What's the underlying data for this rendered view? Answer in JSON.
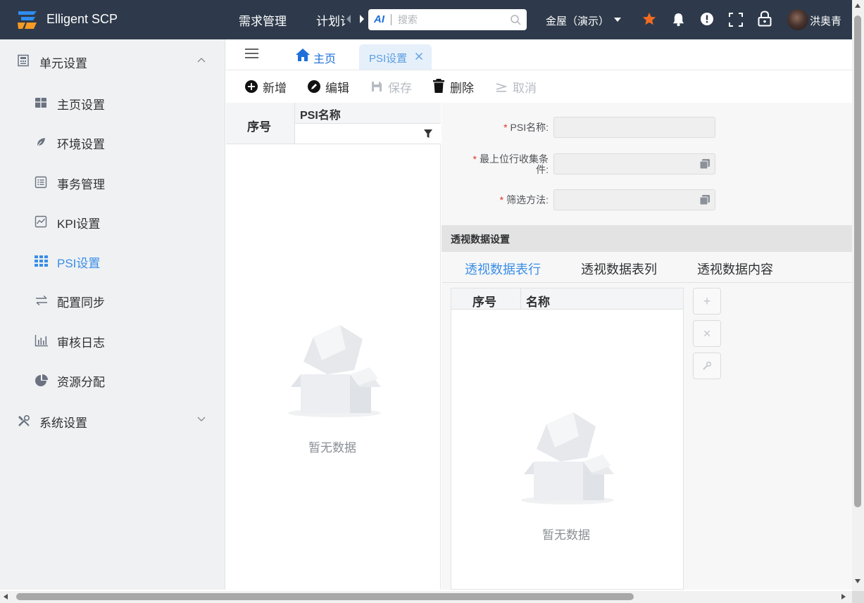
{
  "header": {
    "brand": "Elligent SCP",
    "nav": [
      "需求管理",
      "计划计"
    ],
    "search": {
      "ai_label": "AI",
      "placeholder": "搜索"
    },
    "tenant": "金屋（演示）",
    "user": "洪奥青",
    "icons": [
      "star-icon",
      "bell-icon",
      "alert-icon",
      "fullscreen-icon",
      "lock-icon"
    ],
    "colors": {
      "bar": "#2e3a4b",
      "star": "#f26b21"
    }
  },
  "sidebar": {
    "group1": "单元设置",
    "items": [
      {
        "label": "主页设置",
        "icon": "home-grid-icon"
      },
      {
        "label": "环境设置",
        "icon": "leaf-icon"
      },
      {
        "label": "事务管理",
        "icon": "list-icon"
      },
      {
        "label": "KPI设置",
        "icon": "line-chart-icon"
      },
      {
        "label": "PSI设置",
        "icon": "grid-icon",
        "active": true
      },
      {
        "label": "配置同步",
        "icon": "sync-arrows-icon"
      },
      {
        "label": "审核日志",
        "icon": "bar-chart-icon"
      },
      {
        "label": "资源分配",
        "icon": "pie-chart-icon"
      }
    ],
    "group2": "系统设置"
  },
  "tabs": {
    "home": "主页",
    "active": "PSI设置"
  },
  "toolbar": {
    "add": "新增",
    "edit": "编辑",
    "save": "保存",
    "delete": "删除",
    "cancel": "取消"
  },
  "left_grid": {
    "col_index": "序号",
    "col_name": "PSI名称",
    "empty": "暂无数据"
  },
  "form": {
    "psi_name_label": "PSI名称:",
    "condition_label_1": "最上位行收集条",
    "condition_label_2": "件:",
    "filter_label": "筛选方法:"
  },
  "pivot": {
    "section": "透视数据设置",
    "tabs": [
      "透视数据表行",
      "透视数据表列",
      "透视数据内容"
    ],
    "col_index": "序号",
    "col_name": "名称",
    "empty": "暂无数据",
    "buttons": [
      "+",
      "×"
    ]
  },
  "accent_color": "#3a8ee6"
}
